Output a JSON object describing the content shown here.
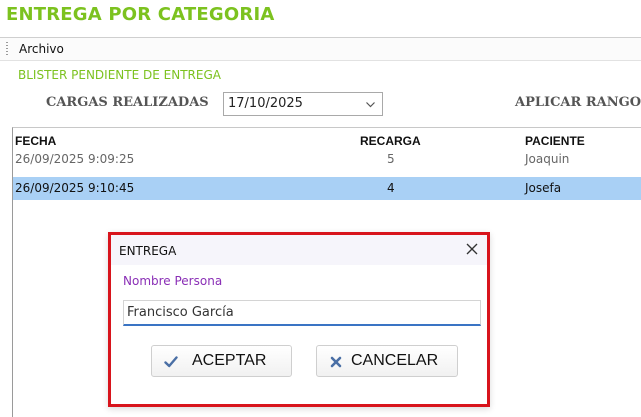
{
  "page": {
    "title": "ENTREGA POR CATEGORIA"
  },
  "menu": {
    "items": [
      "Archivo"
    ]
  },
  "section": {
    "label": "BLISTER PENDIENTE DE ENTREGA"
  },
  "filter": {
    "cargas_label": "CARGAS  REALIZADAS",
    "date_value": "17/10/2025",
    "apply_label": "APLICAR RANGO"
  },
  "table": {
    "columns": [
      "FECHA",
      "RECARGA",
      "PACIENTE"
    ],
    "rows": [
      {
        "fecha": "26/09/2025 9:09:25",
        "recarga": "5",
        "paciente": "Joaquin",
        "selected": false
      },
      {
        "fecha": "26/09/2025 9:10:45",
        "recarga": "4",
        "paciente": "Josefa",
        "selected": true
      }
    ]
  },
  "dialog": {
    "title": "ENTREGA",
    "field_label": "Nombre Persona",
    "field_value": "Francisco García",
    "ok_label": "ACEPTAR",
    "cancel_label": "CANCELAR"
  },
  "colors": {
    "title_green": "#7cc21f",
    "selection_blue": "#a9d0f5",
    "dialog_border_red": "#d8141c",
    "field_label_purple": "#8a2fb6",
    "input_underline_blue": "#3a74c4",
    "icon_blue": "#4a6fa5"
  },
  "icons": {
    "date_dropdown": "chevron-down-icon",
    "dialog_close": "close-icon",
    "ok_button": "check-icon",
    "cancel_button": "x-icon"
  }
}
